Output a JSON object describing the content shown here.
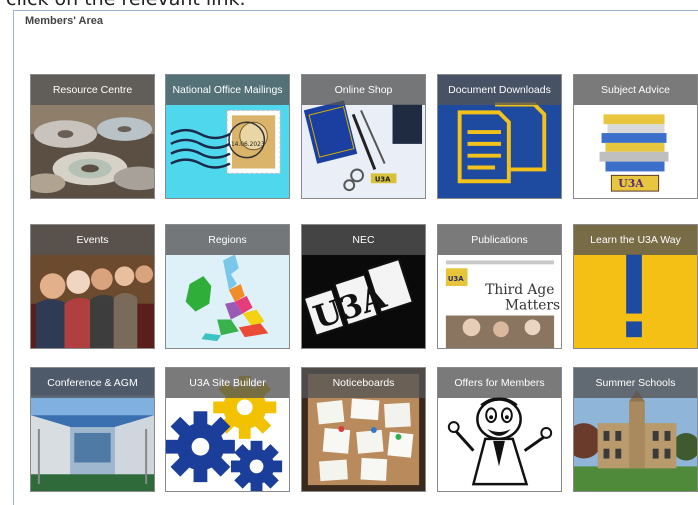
{
  "top_text": "click on the relevant link.",
  "heading": "Members' Area",
  "tiles": [
    {
      "label": "Resource Centre"
    },
    {
      "label": "National Office Mailings"
    },
    {
      "label": "Online Shop"
    },
    {
      "label": "Document Downloads"
    },
    {
      "label": "Subject Advice"
    },
    {
      "label": "Events"
    },
    {
      "label": "Regions"
    },
    {
      "label": "NEC"
    },
    {
      "label": "Publications"
    },
    {
      "label": "Learn the U3A Way"
    },
    {
      "label": "Conference & AGM"
    },
    {
      "label": "U3A Site Builder"
    },
    {
      "label": "Noticeboards"
    },
    {
      "label": "Offers for Members"
    },
    {
      "label": "Summer Schools"
    }
  ],
  "art_text": {
    "shop_badge": "U3A",
    "subject_badge": "U3A",
    "nec_word": "U3A",
    "pub_title_1": "Third Age",
    "pub_title_2": "Matters",
    "pub_header": "U3A",
    "learn_mark": "!",
    "stamp_text": "14.06.2023"
  }
}
